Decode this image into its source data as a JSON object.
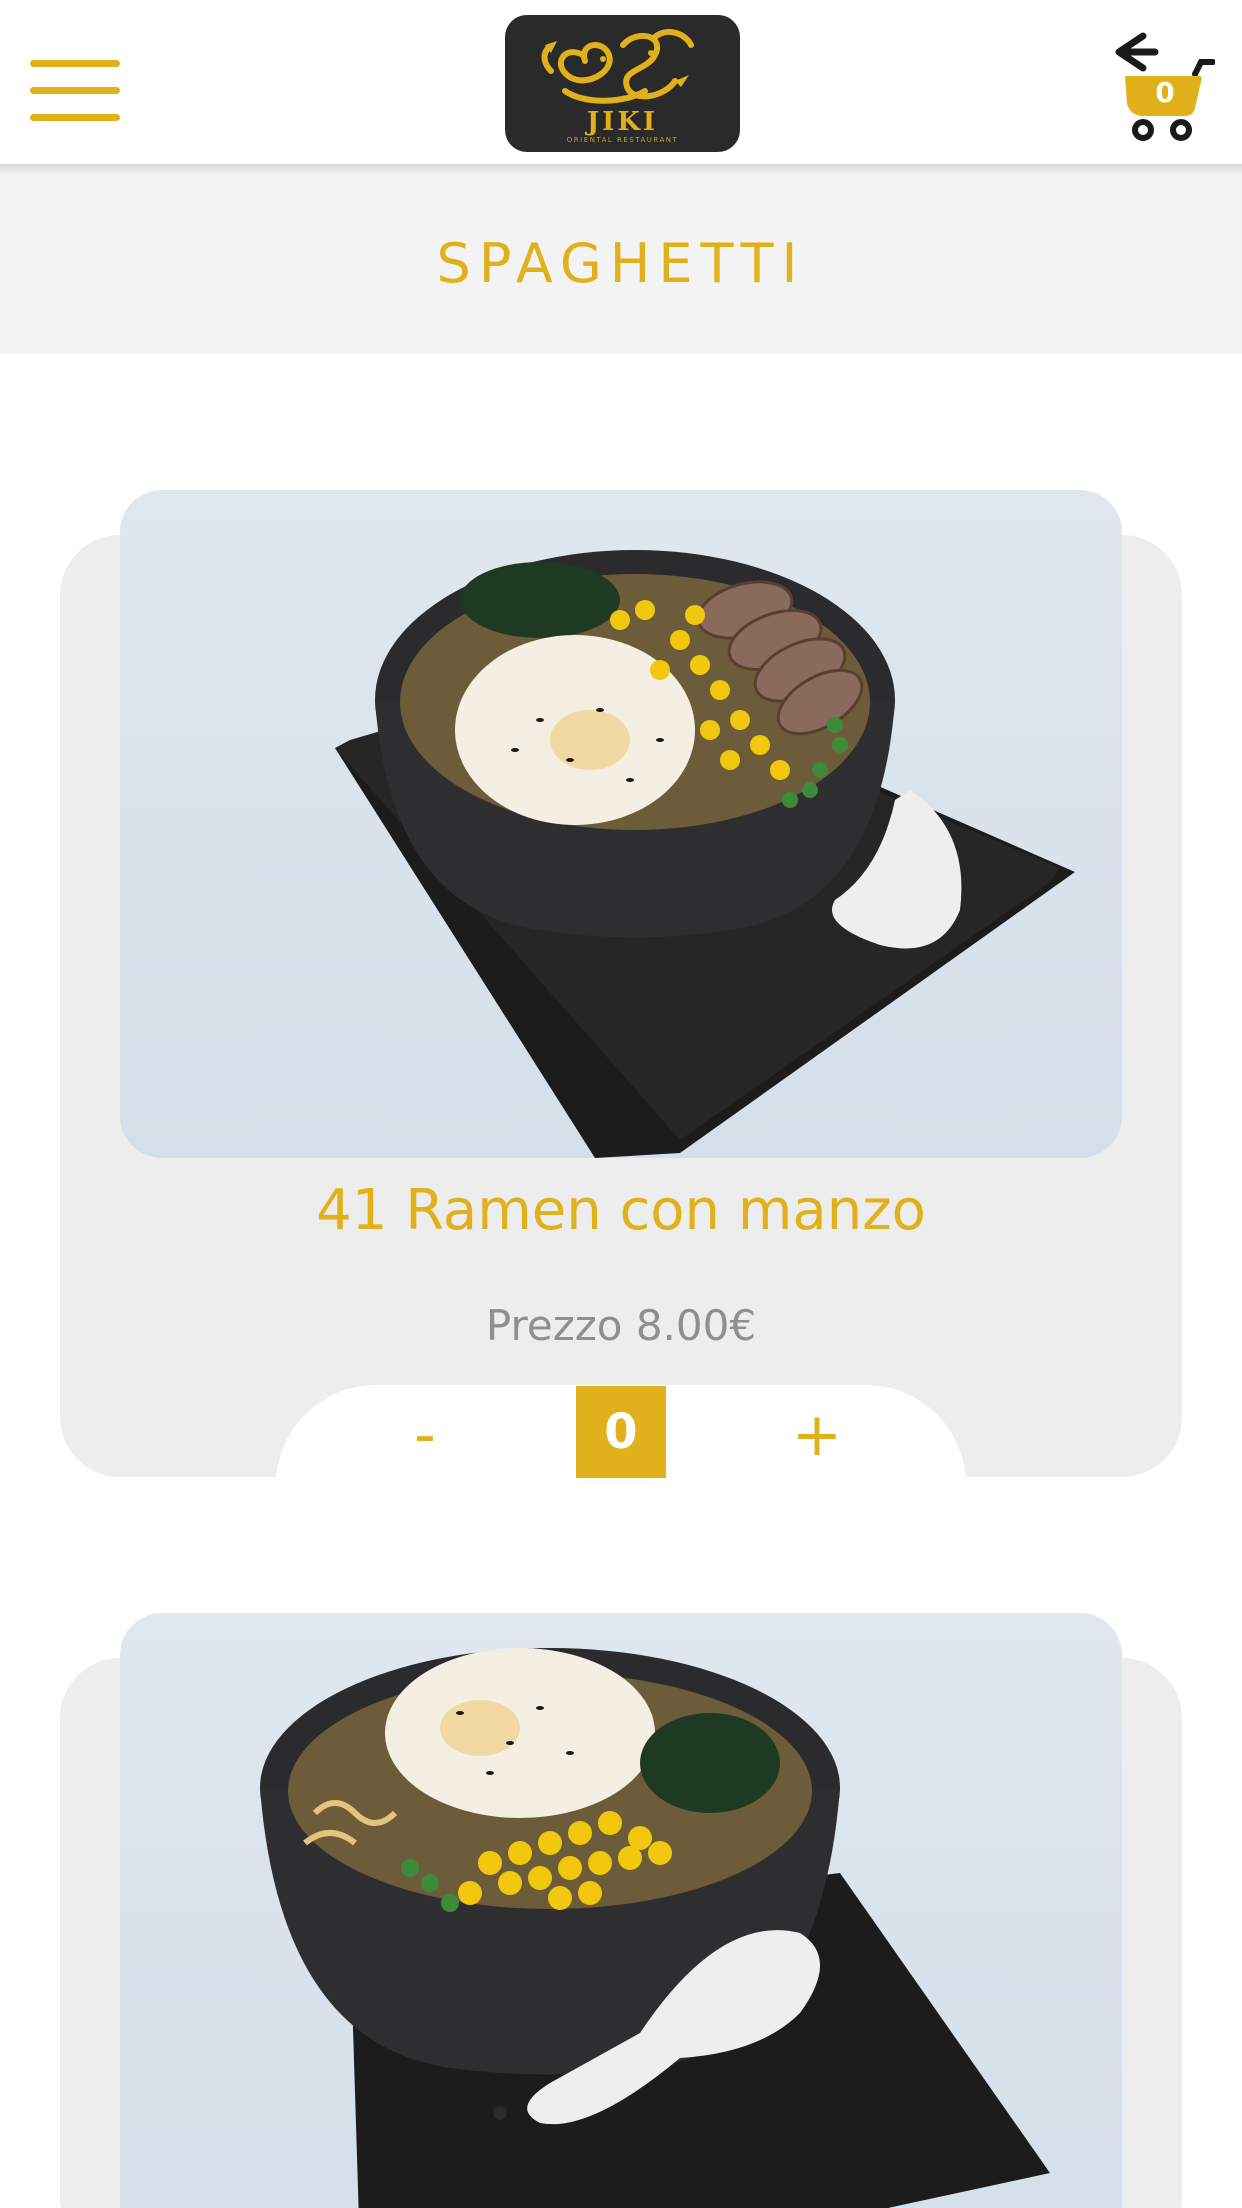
{
  "header": {
    "menu_icon": "hamburger-menu-icon",
    "logo": {
      "name": "JIKI",
      "subtitle": "ORIENTAL RESTAURANT"
    },
    "cart": {
      "icon": "shopping-cart-icon",
      "count": "0"
    }
  },
  "category": {
    "title": "SPAGHETTI"
  },
  "products": [
    {
      "name": "41 Ramen con manzo",
      "price": "Prezzo 8.00€",
      "quantity": "0",
      "minus_label": "-",
      "plus_label": "+",
      "image": "ramen-with-beef-egg-corn-photo"
    },
    {
      "image": "ramen-with-egg-corn-seaweed-photo"
    }
  ],
  "colors": {
    "accent": "#e0b11b",
    "card_bg": "#ededed",
    "band_bg": "#f3f3f3",
    "price_text": "#8f8f8f"
  }
}
